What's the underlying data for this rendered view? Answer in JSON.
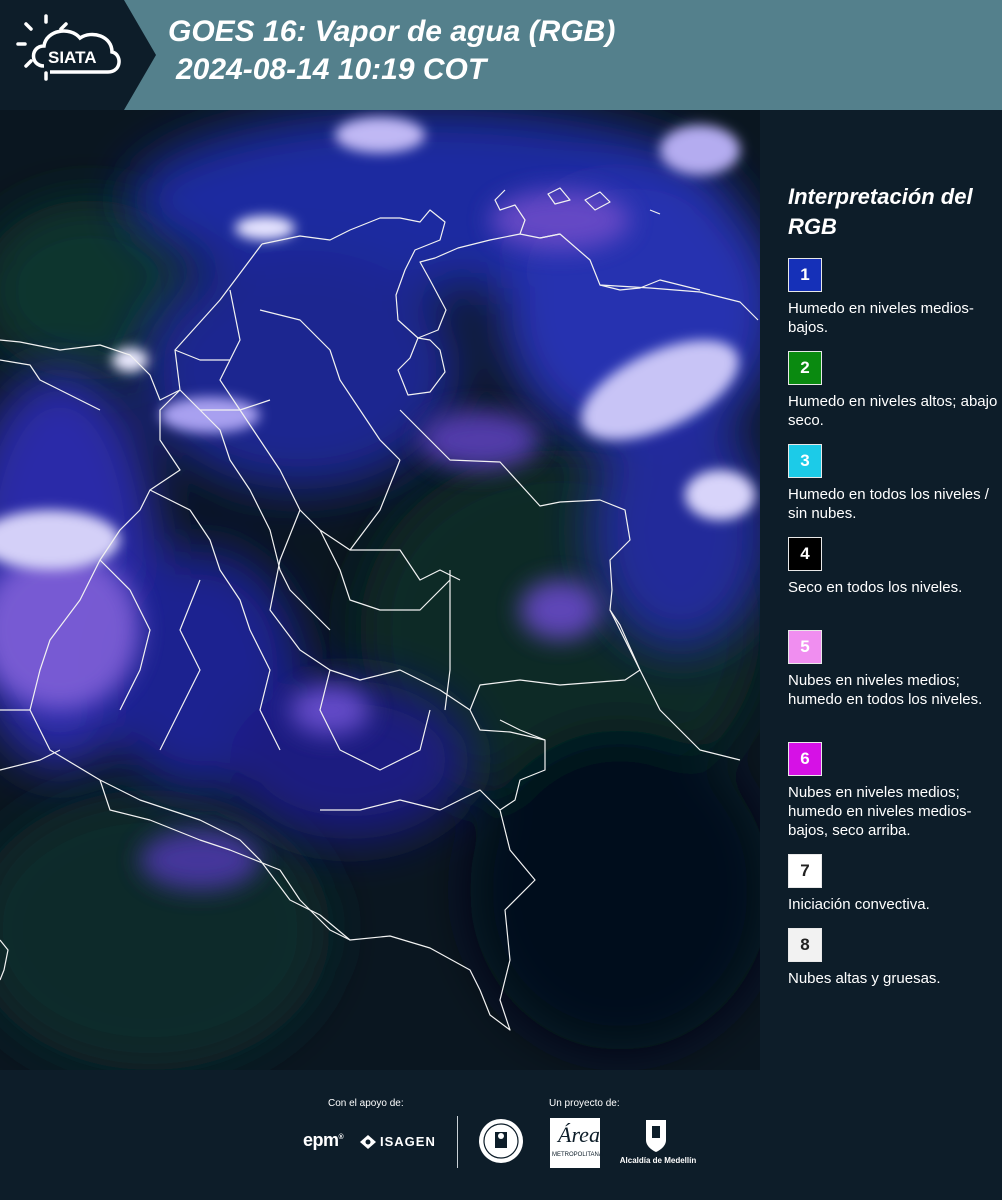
{
  "header": {
    "title": "GOES 16: Vapor de agua (RGB)",
    "subtitle": "2024-08-14 10:19 COT",
    "logo_text": "SIATA"
  },
  "legend": {
    "title": "Interpretación del RGB",
    "items": [
      {
        "number": "1",
        "color": "#1530b8",
        "text_color": "#ffffff",
        "label": "Humedo en niveles medios-bajos."
      },
      {
        "number": "2",
        "color": "#0a8a10",
        "text_color": "#ffffff",
        "label": "Humedo en niveles altos; abajo seco."
      },
      {
        "number": "3",
        "color": "#1ccbe8",
        "text_color": "#ffffff",
        "label": "Humedo en todos los niveles / sin nubes."
      },
      {
        "number": "4",
        "color": "#000000",
        "text_color": "#ffffff",
        "label": "Seco en todos los niveles."
      },
      {
        "number": "5",
        "color": "#f08ef0",
        "text_color": "#ffffff",
        "label": "Nubes en niveles medios; humedo en todos los niveles."
      },
      {
        "number": "6",
        "color": "#d611e6",
        "text_color": "#ffffff",
        "label": "Nubes en niveles medios; humedo en niveles medios-bajos, seco arriba."
      },
      {
        "number": "7",
        "color": "#ffffff",
        "text_color": "#222222",
        "label": "Iniciación convectiva."
      },
      {
        "number": "8",
        "color": "#f2f2f2",
        "text_color": "#222222",
        "label": "Nubes altas y gruesas."
      }
    ]
  },
  "footer": {
    "support_label": "Con el apoyo de:",
    "project_label": "Un proyecto de:",
    "sponsors": [
      "epm",
      "ISAGEN"
    ],
    "metro_text": "METROPOLITANA",
    "metro_mark": "Área",
    "medellin_label": "Alcaldía de Medellín"
  },
  "map": {
    "satellite": "GOES 16",
    "product": "Vapor de agua (RGB)",
    "colors": {
      "dark": "#08141c",
      "moist_blue": "#2a2fb5",
      "mid_cloud": "#7b5bd8",
      "thick_cloud": "#e8e4ff",
      "green": "#113a2a"
    }
  }
}
